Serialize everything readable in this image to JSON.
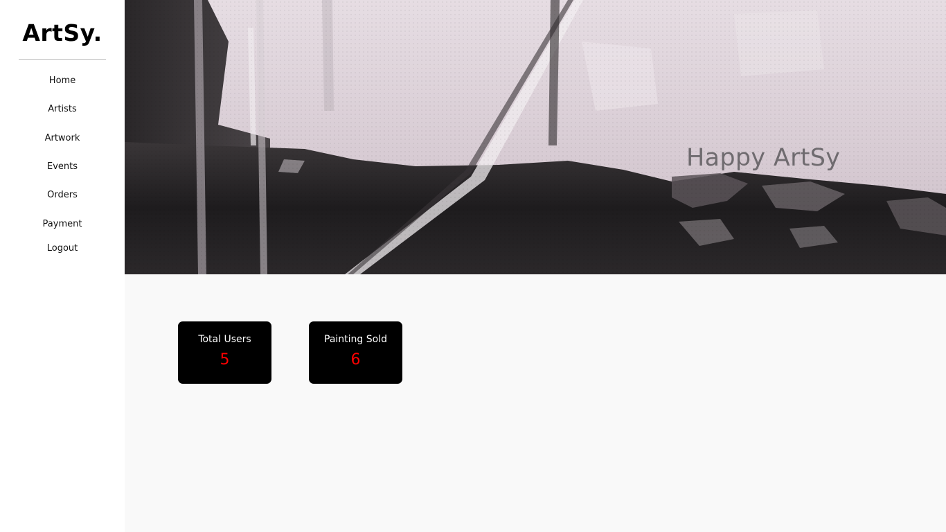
{
  "sidebar": {
    "brand": "ArtSy.",
    "nav": [
      {
        "label": "Home"
      },
      {
        "label": "Artists"
      },
      {
        "label": "Artwork"
      },
      {
        "label": "Events"
      },
      {
        "label": "Orders"
      },
      {
        "label": "Payment"
      },
      {
        "label": "Logout"
      }
    ]
  },
  "hero": {
    "caption": "Happy ArtSy"
  },
  "stats": [
    {
      "label": "Total Users",
      "value": "5"
    },
    {
      "label": "Painting Sold",
      "value": "6"
    }
  ],
  "colors": {
    "card_background": "#000000",
    "stat_value": "#ff0000",
    "page_background": "#f9f9f9"
  }
}
